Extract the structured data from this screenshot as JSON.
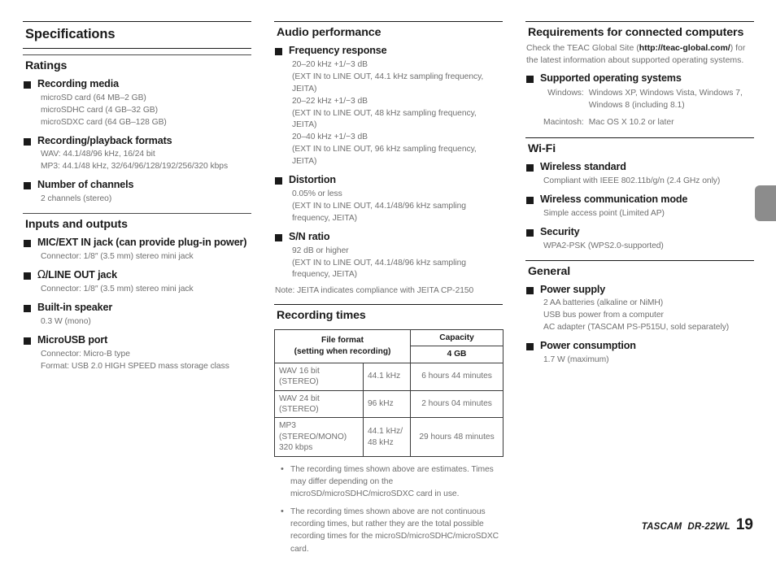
{
  "document": {
    "title": "Specifications"
  },
  "column1": {
    "sections": [
      {
        "title": "Ratings",
        "items": [
          {
            "heading": "Recording media",
            "lines": [
              "microSD card (64 MB–2 GB)",
              "microSDHC card (4 GB–32 GB)",
              "microSDXC card (64 GB–128 GB)"
            ]
          },
          {
            "heading": "Recording/playback formats",
            "lines": [
              "WAV: 44.1/48/96 kHz, 16/24 bit",
              "MP3: 44.1/48 kHz, 32/64/96/128/192/256/320 kbps"
            ]
          },
          {
            "heading": "Number of channels",
            "lines": [
              "2 channels (stereo)"
            ]
          }
        ]
      },
      {
        "title": "Inputs and outputs",
        "items": [
          {
            "heading": "MIC/EXT IN jack (can provide plug-in power)",
            "lines": [
              "Connector: 1/8″ (3.5 mm) stereo mini jack"
            ]
          },
          {
            "heading": "/LINE OUT jack",
            "glyph": "Ω",
            "glyph_name": "headphones-icon",
            "lines": [
              "Connector: 1/8″ (3.5 mm) stereo mini jack"
            ]
          },
          {
            "heading": "Built-in speaker",
            "lines": [
              "0.3 W (mono)"
            ]
          },
          {
            "heading": "MicroUSB port",
            "lines": [
              "Connector: Micro-B type",
              "Format: USB 2.0 HIGH SPEED mass storage class"
            ]
          }
        ]
      }
    ]
  },
  "column2": {
    "audio": {
      "title": "Audio performance",
      "items": [
        {
          "heading": "Frequency response",
          "lines": [
            "20–20 kHz +1/−3 dB",
            "(EXT IN to LINE OUT, 44.1 kHz sampling frequency, JEITA)",
            "20–22 kHz +1/−3 dB",
            "(EXT IN to LINE OUT, 48 kHz sampling frequency, JEITA)",
            "20–40 kHz +1/−3 dB",
            "(EXT IN to LINE OUT, 96 kHz sampling frequency, JEITA)"
          ]
        },
        {
          "heading": "Distortion",
          "lines": [
            "0.05% or less",
            "(EXT IN to LINE OUT, 44.1/48/96 kHz sampling frequency, JEITA)"
          ]
        },
        {
          "heading": "S/N ratio",
          "lines": [
            "92 dB or higher",
            "(EXT IN to LINE OUT, 44.1/48/96 kHz sampling frequency, JEITA)"
          ]
        }
      ],
      "note": "Note: JEITA indicates compliance with JEITA CP-2150"
    },
    "recording_times": {
      "title": "Recording times",
      "table": {
        "header_format": "File format",
        "header_format_sub": "(setting when recording)",
        "header_capacity": "Capacity",
        "header_capacity_value": "4 GB",
        "rows": [
          {
            "format": "WAV 16 bit (STEREO)",
            "rate": "44.1 kHz",
            "time": "6 hours 44 minutes"
          },
          {
            "format": "WAV 24 bit (STEREO)",
            "rate": "96 kHz",
            "time": "2 hours 04 minutes"
          },
          {
            "format": "MP3 (STEREO/MONO) 320 kbps",
            "rate": "44.1 kHz/ 48 kHz",
            "time": "29 hours 48 minutes"
          }
        ]
      },
      "notes": [
        "The recording times shown above are estimates. Times may differ depending on the microSD/microSDHC/microSDXC card in use.",
        "The recording times shown above are not continuous recording times, but rather they are the total possible recording times for the microSD/microSDHC/microSDXC card."
      ]
    }
  },
  "column3": {
    "requirements": {
      "title": "Requirements for connected computers",
      "intro_before": "Check the TEAC Global Site (",
      "intro_link": "http://teac-global.com/",
      "intro_after": ") for the latest information about supported operating systems.",
      "item_heading": "Supported operating systems",
      "os_rows": [
        {
          "label": "Windows:",
          "value": "Windows XP, Windows Vista, Windows 7, Windows 8 (including 8.1)"
        },
        {
          "label": "Macintosh:",
          "value": "Mac OS X 10.2 or later"
        }
      ]
    },
    "wifi": {
      "title": "Wi-Fi",
      "items": [
        {
          "heading": "Wireless standard",
          "lines": [
            "Compliant with IEEE 802.11b/g/n (2.4 GHz only)"
          ]
        },
        {
          "heading": "Wireless communication mode",
          "lines": [
            "Simple access point (Limited AP)"
          ]
        },
        {
          "heading": "Security",
          "lines": [
            "WPA2-PSK (WPS2.0-supported)"
          ]
        }
      ]
    },
    "general": {
      "title": "General",
      "items": [
        {
          "heading": "Power supply",
          "lines": [
            "2 AA batteries (alkaline or NiMH)",
            "USB bus power from a computer",
            "AC adapter (TASCAM PS-P515U, sold separately)"
          ]
        },
        {
          "heading": "Power consumption",
          "lines": [
            "1.7 W (maximum)"
          ]
        }
      ]
    }
  },
  "footer": {
    "brand": "TASCAM",
    "model": "DR-22WL",
    "page_number": "19"
  }
}
